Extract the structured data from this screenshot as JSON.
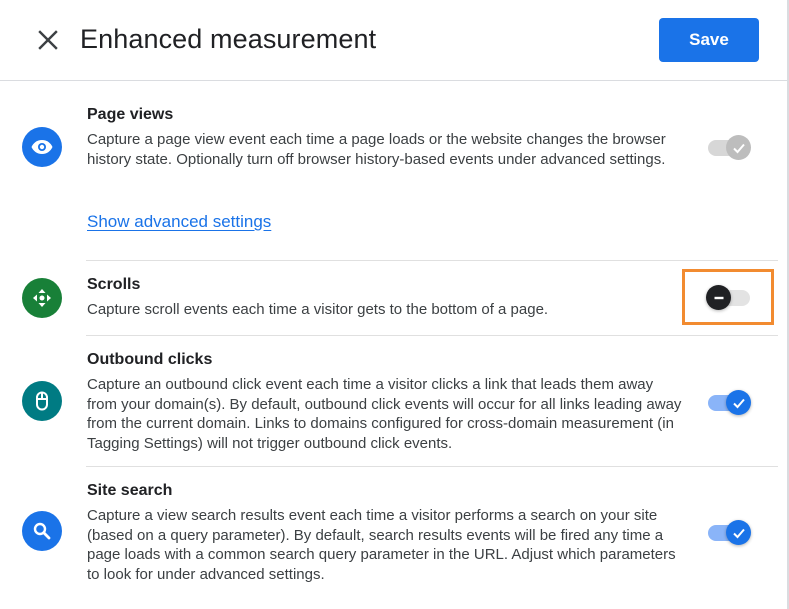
{
  "header": {
    "title": "Enhanced measurement",
    "save_label": "Save",
    "close_icon": "close-icon"
  },
  "colors": {
    "primary": "#1a73e8",
    "scrolls_icon_bg": "#188038",
    "outbound_icon_bg": "#007b83",
    "highlight": "#f28b30"
  },
  "rows": [
    {
      "id": "page-views",
      "icon": "eye-icon",
      "title": "Page views",
      "description": "Capture a page view event each time a page loads or the website changes the browser history state. Optionally turn off browser history-based events under advanced settings.",
      "link": "Show advanced settings",
      "toggle_state": "on (disabled)"
    },
    {
      "id": "scrolls",
      "icon": "scroll-arrows-icon",
      "title": "Scrolls",
      "description": "Capture scroll events each time a visitor gets to the bottom of a page.",
      "toggle_state": "off"
    },
    {
      "id": "outbound-clicks",
      "icon": "mouse-icon",
      "title": "Outbound clicks",
      "description": "Capture an outbound click event each time a visitor clicks a link that leads them away from your domain(s). By default, outbound click events will occur for all links leading away from the current domain. Links to domains configured for cross-domain measurement (in Tagging Settings) will not trigger outbound click events.",
      "toggle_state": "on"
    },
    {
      "id": "site-search",
      "icon": "search-icon",
      "title": "Site search",
      "description": "Capture a view search results event each time a visitor performs a search on your site (based on a query parameter). By default, search results events will be fired any time a page loads with a common search query parameter in the URL. Adjust which parameters to look for under advanced settings.",
      "toggle_state": "on"
    }
  ]
}
